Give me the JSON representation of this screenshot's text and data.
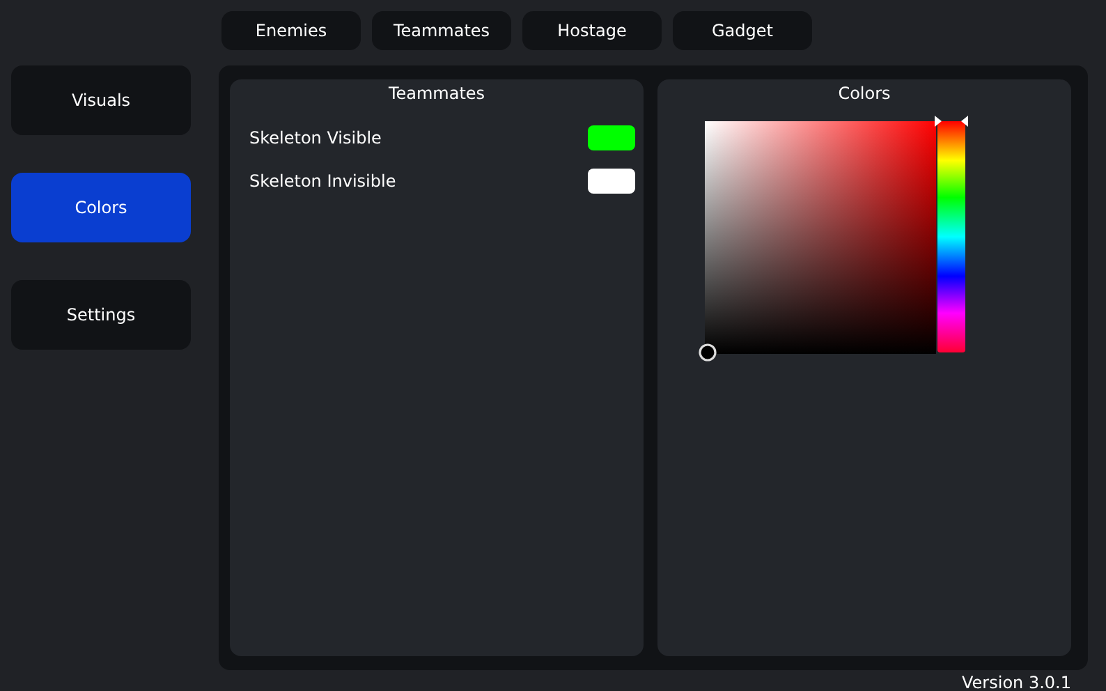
{
  "top_tabs": [
    {
      "label": "Enemies"
    },
    {
      "label": "Teammates"
    },
    {
      "label": "Hostage"
    },
    {
      "label": "Gadget"
    }
  ],
  "sidebar": {
    "items": [
      {
        "label": "Visuals",
        "selected": false
      },
      {
        "label": "Colors",
        "selected": true
      },
      {
        "label": "Settings",
        "selected": false
      }
    ]
  },
  "left_panel": {
    "title": "Teammates",
    "rows": [
      {
        "label": "Skeleton Visible",
        "color": "#00ff00"
      },
      {
        "label": "Skeleton Invisible",
        "color": "#ffffff"
      }
    ]
  },
  "right_panel": {
    "title": "Colors",
    "hue": {
      "level": 0
    }
  },
  "version": "Version 3.0.1"
}
